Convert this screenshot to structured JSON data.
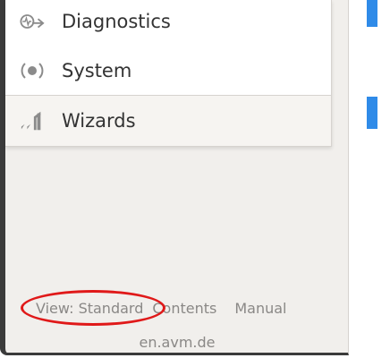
{
  "menu": {
    "items": [
      {
        "label": "Diagnostics",
        "icon": "diagnostics-icon"
      },
      {
        "label": "System",
        "icon": "system-icon"
      },
      {
        "label": "Wizards",
        "icon": "wizards-icon"
      }
    ]
  },
  "footer": {
    "view_label": "View: Standard",
    "contents_label": "Contents",
    "manual_label": "Manual",
    "domain": "en.avm.de"
  },
  "colors": {
    "accent": "#2f8be8",
    "highlight_circle": "#e01919",
    "sidebar_bg": "#f1efec"
  }
}
